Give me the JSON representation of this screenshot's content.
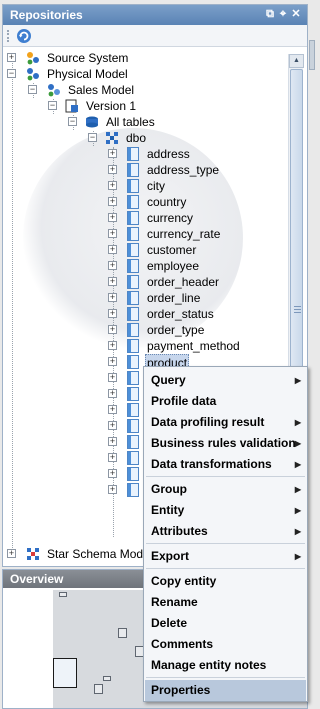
{
  "repositories": {
    "title": "Repositories",
    "controls": [
      "restore-icon",
      "pin-icon",
      "close-icon"
    ],
    "toolbar": {
      "refresh_icon": "refresh-icon"
    }
  },
  "tree": {
    "source_system": "Source System",
    "physical_model": "Physical Model",
    "sales_model": "Sales Model",
    "version": "Version 1",
    "all_tables": "All tables",
    "schema": "dbo",
    "tables": [
      "address",
      "address_type",
      "city",
      "country",
      "currency",
      "currency_rate",
      "customer",
      "employee",
      "order_header",
      "order_line",
      "order_status",
      "order_type",
      "payment_method",
      "product"
    ],
    "selected": "product",
    "star_schema": "Star Schema Mode"
  },
  "overview": {
    "title": "Overview"
  },
  "context_menu": {
    "items": [
      {
        "label": "Query",
        "submenu": true
      },
      {
        "label": "Profile data",
        "submenu": false
      },
      {
        "label": "Data profiling result",
        "submenu": true
      },
      {
        "label": "Business rules validation",
        "submenu": true
      },
      {
        "label": "Data transformations",
        "submenu": true
      },
      {
        "label": "Group",
        "submenu": true
      },
      {
        "label": "Entity",
        "submenu": true
      },
      {
        "label": "Attributes",
        "submenu": true
      },
      {
        "label": "Export",
        "submenu": true
      },
      {
        "label": "Copy entity",
        "submenu": false
      },
      {
        "label": "Rename",
        "submenu": false
      },
      {
        "label": "Delete",
        "submenu": false
      },
      {
        "label": "Comments",
        "submenu": false
      },
      {
        "label": "Manage entity notes",
        "submenu": false
      },
      {
        "label": "Properties",
        "submenu": false
      }
    ],
    "highlighted": "Properties"
  },
  "colors": {
    "header": "#6b90c0",
    "selection": "#c7d6ec",
    "menu_highlight": "#b8c8dc"
  }
}
